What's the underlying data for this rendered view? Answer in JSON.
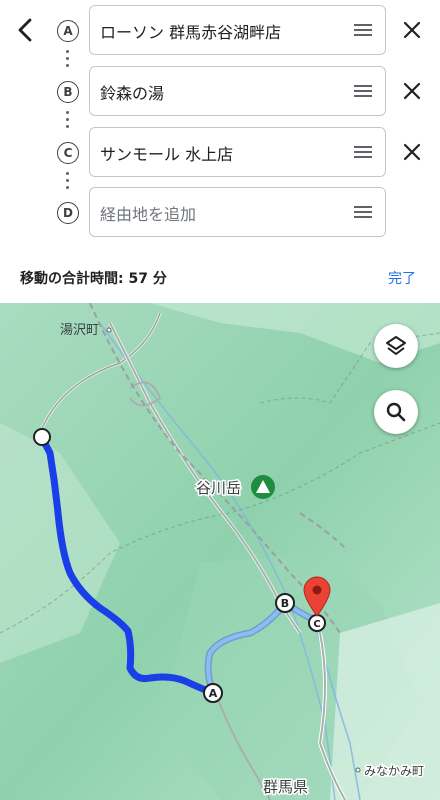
{
  "header": {
    "back_icon": "back-arrow-icon"
  },
  "stops": [
    {
      "letter": "Ⓐ",
      "value": "ローソン 群馬赤谷湖畔店",
      "placeholder": ""
    },
    {
      "letter": "Ⓑ",
      "value": "鈴森の湯",
      "placeholder": ""
    },
    {
      "letter": "Ⓒ",
      "value": "サンモール 水上店",
      "placeholder": ""
    },
    {
      "letter": "Ⓓ",
      "value": "",
      "placeholder": "経由地を追加"
    }
  ],
  "summary": {
    "total_time": "移動の合計時間: 57 分",
    "done_label": "完了"
  },
  "map": {
    "labels": {
      "yuzawa": "湯沢町",
      "tanigawa": "谷川岳",
      "gunma": "群馬県",
      "minakami": "みなかみ町"
    },
    "markers": {
      "a": "A",
      "b": "B",
      "c": "C"
    },
    "route_color": "#1a3ee8",
    "alt_route_color": "#6fa8ff",
    "destination_color": "#ea4335"
  }
}
